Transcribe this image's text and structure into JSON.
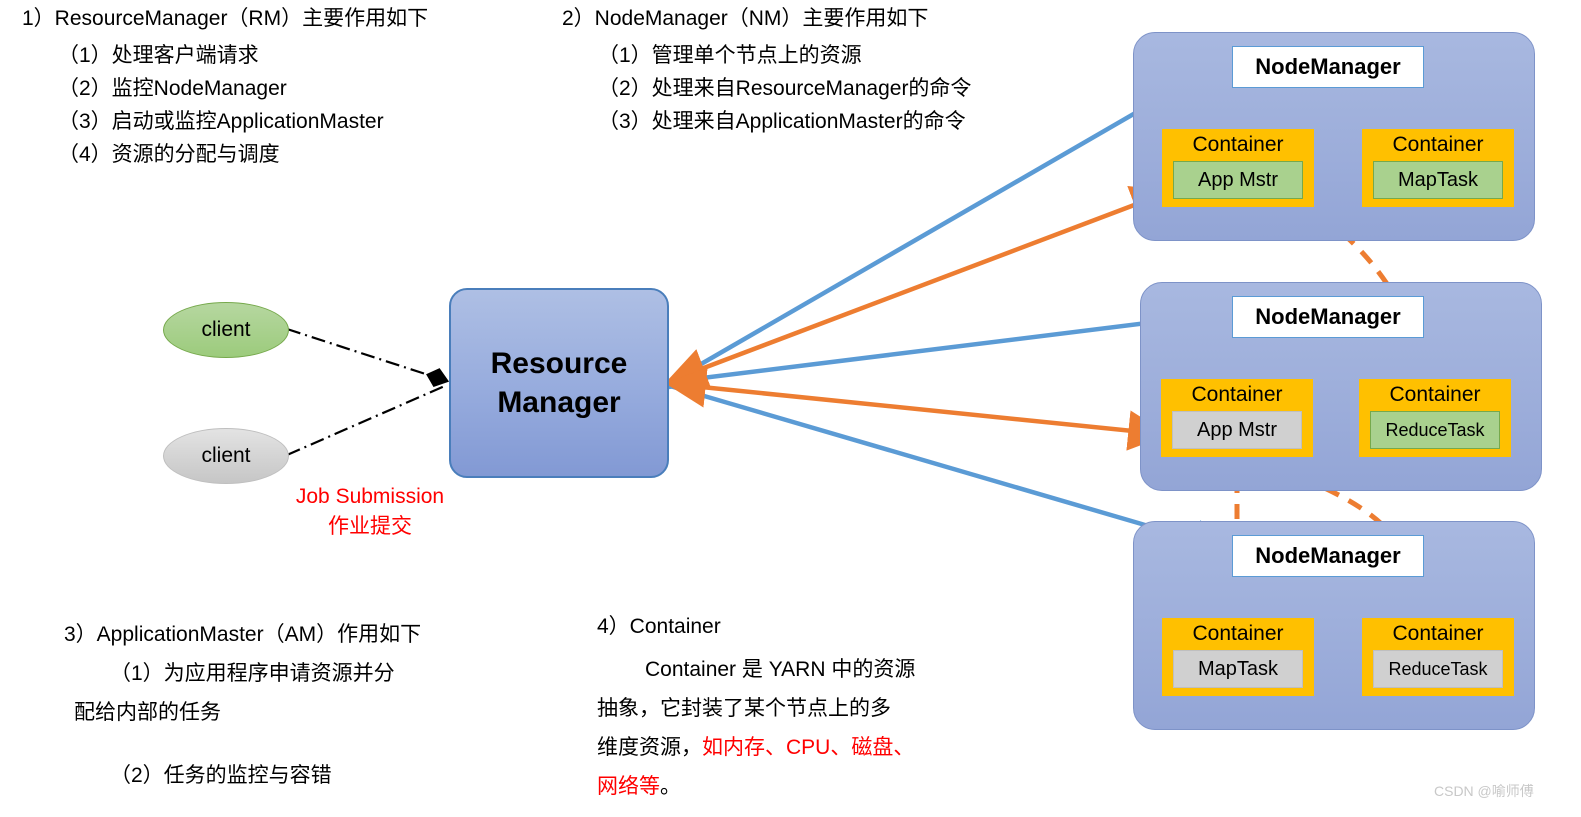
{
  "sections": {
    "rm_block": {
      "heading": "1）ResourceManager（RM）主要作用如下",
      "items": [
        "（1）处理客户端请求",
        "（2）监控NodeManager",
        "（3）启动或监控ApplicationMaster",
        "（4）资源的分配与调度"
      ]
    },
    "nm_block": {
      "heading": "2）NodeManager（NM）主要作用如下",
      "items": [
        "（1）管理单个节点上的资源",
        "（2）处理来自ResourceManager的命令",
        "（3）处理来自ApplicationMaster的命令"
      ]
    },
    "am_block": {
      "heading": "3）ApplicationMaster（AM）作用如下",
      "line1": "（1）为应用程序申请资源并分",
      "line2": "配给内部的任务",
      "line3": "（2）任务的监控与容错"
    },
    "container_block": {
      "heading": "4）Container",
      "line1": "Container 是 YARN 中的资源",
      "line2": "抽象，它封装了某个节点上的多",
      "line3_black": "维度资源，",
      "line3_red": "如内存、CPU、磁盘、",
      "line4_red": "网络等",
      "line4_black": "。"
    }
  },
  "diagram": {
    "clients": [
      {
        "label": "client",
        "color": "#9CCB7C"
      },
      {
        "label": "client",
        "color": "#C6C6C6"
      }
    ],
    "resource_manager": {
      "line1": "Resource",
      "line2": "Manager",
      "fill": "#96ABDD",
      "border": "#4A7EBB"
    },
    "job_submission": {
      "line1": "Job Submission",
      "line2": "作业提交",
      "color": "#FF0000"
    },
    "clusters": [
      {
        "title": "NodeManager",
        "containers": [
          {
            "title": "Container",
            "task": "App Mstr",
            "task_color": "green"
          },
          {
            "title": "Container",
            "task": "MapTask",
            "task_color": "green"
          }
        ]
      },
      {
        "title": "NodeManager",
        "containers": [
          {
            "title": "Container",
            "task": "App Mstr",
            "task_color": "gray"
          },
          {
            "title": "Container",
            "task": "ReduceTask",
            "task_color": "green"
          }
        ]
      },
      {
        "title": "NodeManager",
        "containers": [
          {
            "title": "Container",
            "task": "MapTask",
            "task_color": "gray"
          },
          {
            "title": "Container",
            "task": "ReduceTask",
            "task_color": "gray"
          }
        ]
      }
    ],
    "colors": {
      "cluster_fill": "#9CADDA",
      "container_fill": "#FFC000",
      "task_green": "#A9D18E",
      "task_gray": "#D0D0D0",
      "arrow_blue": "#5B9BD5",
      "arrow_orange": "#ED7D31",
      "accent_red": "#FF0000"
    }
  },
  "watermark": "CSDN @喻师傅"
}
